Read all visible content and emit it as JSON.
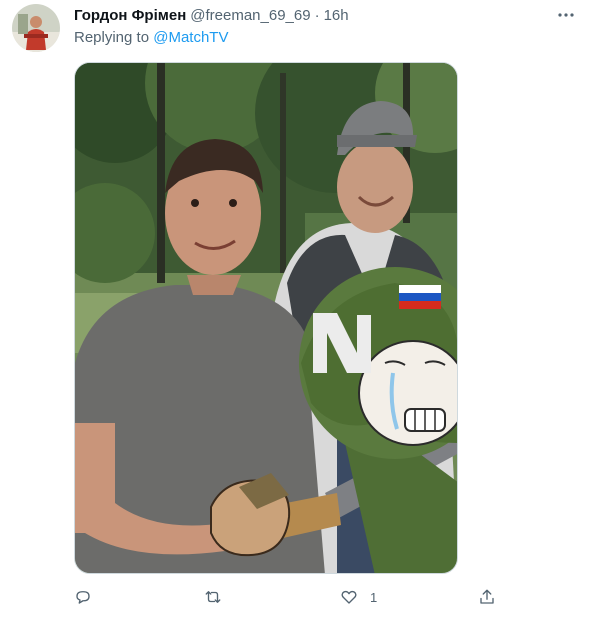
{
  "tweet": {
    "author_name": "Гордон Фрімен",
    "handle": "@freeman_69_69",
    "separator": "·",
    "time": "16h",
    "replying_prefix": "Replying to ",
    "replying_to": "@MatchTV",
    "actions": {
      "reply_count": "",
      "retweet_count": "",
      "like_count": "1"
    }
  },
  "icons": [
    "more-icon",
    "reply-icon",
    "retweet-icon",
    "like-icon",
    "share-icon"
  ],
  "colors": {
    "text_primary": "#0f1419",
    "text_secondary": "#536471",
    "link": "#1d9bf0",
    "border": "#cfd9de"
  }
}
